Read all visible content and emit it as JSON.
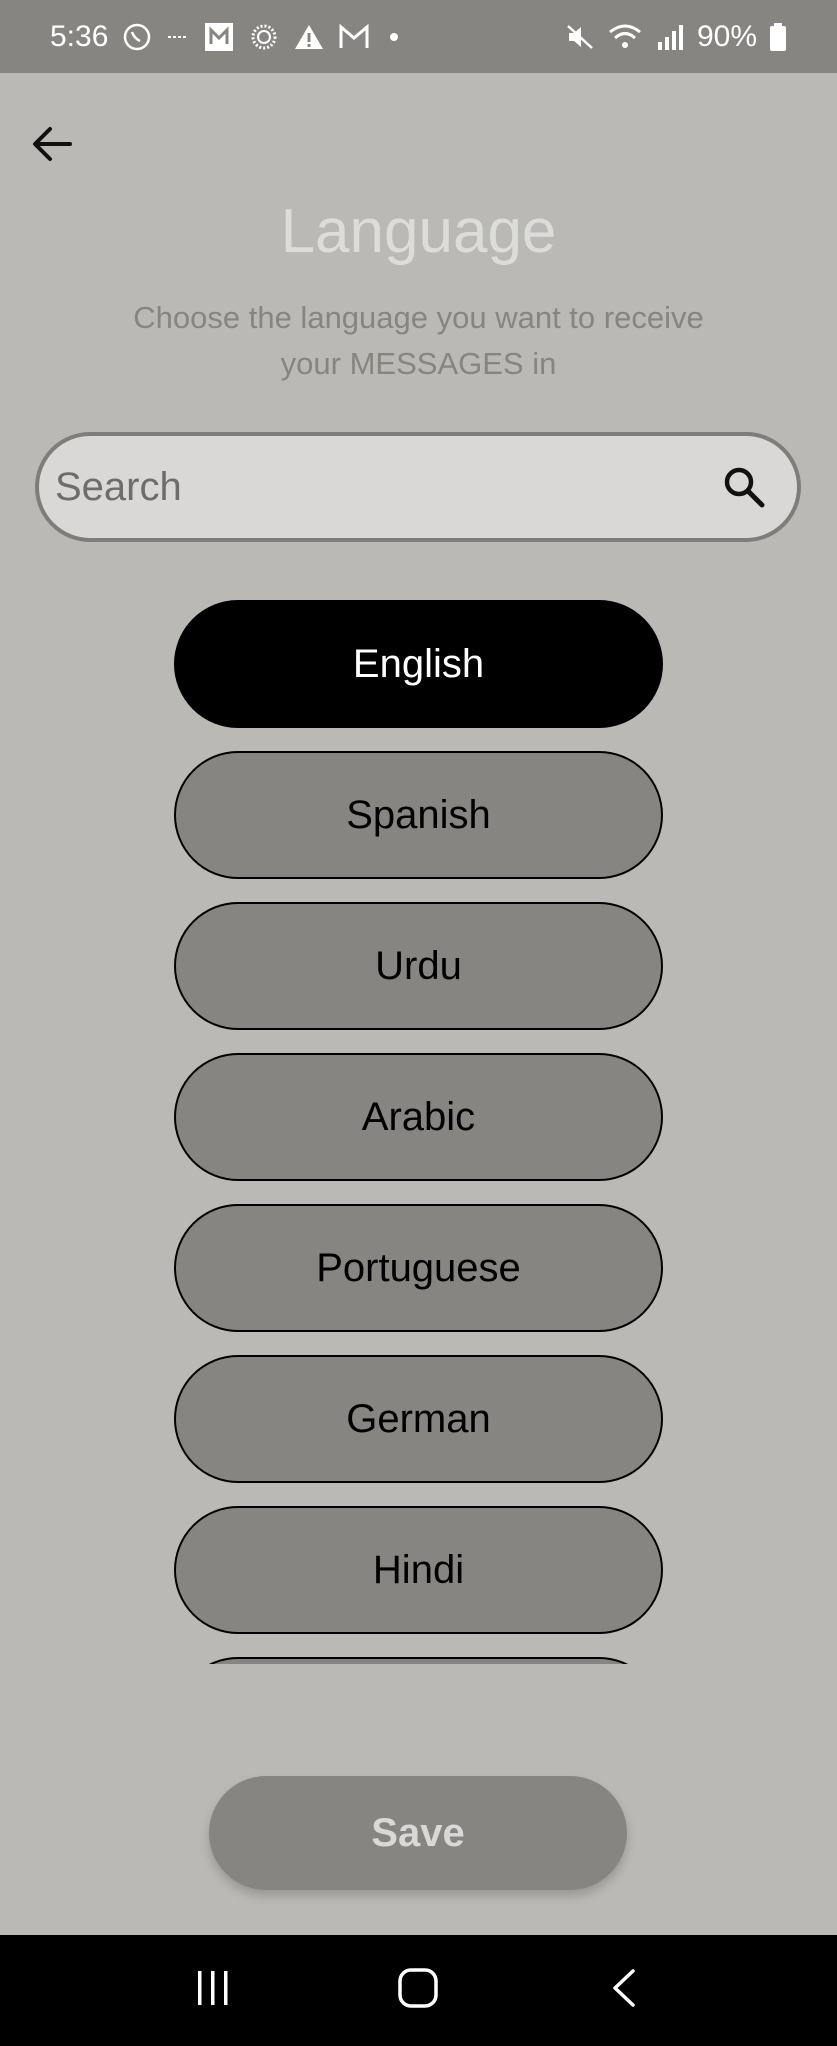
{
  "status_bar": {
    "time": "5:36",
    "battery": "90%",
    "left_icons": [
      "whatsapp-icon",
      "dash-icon",
      "m-icon",
      "sun-icon",
      "warning-icon",
      "gmail-icon",
      "dot-icon"
    ],
    "right_icons": [
      "mute-icon",
      "wifi-icon",
      "signal-icon",
      "battery-icon"
    ]
  },
  "header": {
    "back_icon": "arrow-left-icon",
    "title": "Language",
    "subtitle": "Choose the language you want to receive your MESSAGES in"
  },
  "search": {
    "placeholder": "Search",
    "value": "",
    "icon": "search-icon"
  },
  "languages": [
    {
      "label": "English",
      "selected": true
    },
    {
      "label": "Spanish",
      "selected": false
    },
    {
      "label": "Urdu",
      "selected": false
    },
    {
      "label": "Arabic",
      "selected": false
    },
    {
      "label": "Portuguese",
      "selected": false
    },
    {
      "label": "German",
      "selected": false
    },
    {
      "label": "Hindi",
      "selected": false
    },
    {
      "label": "",
      "selected": false
    }
  ],
  "save_label": "Save",
  "nav_bar": {
    "icons": [
      "recent-apps-icon",
      "home-icon",
      "back-icon"
    ]
  },
  "colors": {
    "background": "#bab9b5",
    "status_bar": "#868581",
    "button_fill": "#868581",
    "selected_fill": "#000000",
    "title_text": "#dcdcda"
  }
}
